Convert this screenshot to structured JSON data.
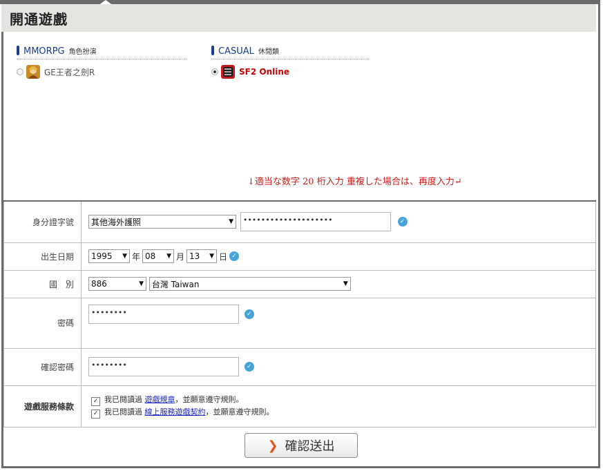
{
  "header": {
    "title": "開通遊戲"
  },
  "categories": [
    {
      "name": "MMORPG",
      "sub": "角色扮演",
      "color": "#1a3d8f"
    },
    {
      "name": "CASUAL",
      "sub": "休閒類",
      "color": "#1a3d8f"
    }
  ],
  "games": [
    {
      "label": "GE王者之劍R",
      "selected": false,
      "icon": "ge-game-icon"
    },
    {
      "label": "SF2 Online",
      "selected": true,
      "icon": "sf2-game-icon"
    }
  ],
  "note": "↓適当な数字 20 桁入力 重複した場合は、再度入力↵",
  "form": {
    "id": {
      "label": "身分證字號",
      "type_value": "其他海外護照",
      "value": "••••••••••••••••••••"
    },
    "birth": {
      "label": "出生日期",
      "year": "1995",
      "year_unit": "年",
      "month": "08",
      "month_unit": "月",
      "day": "13",
      "day_unit": "日"
    },
    "country": {
      "label": "國　別",
      "code": "886",
      "country": "台灣 Taiwan"
    },
    "password": {
      "label": "密碼",
      "value": "••••••••"
    },
    "confirm": {
      "label": "確認密碼",
      "value": "••••••••"
    },
    "terms": {
      "label": "遊戲服務條款",
      "items": [
        {
          "prefix": "我已閱讀過 ",
          "link": "遊戲規章",
          "suffix": "，並願意遵守規則。"
        },
        {
          "prefix": "我已閱讀過 ",
          "link": "線上服務遊戲契約",
          "suffix": "，並願意遵守規則。"
        }
      ]
    }
  },
  "submit": {
    "label": "確認送出"
  }
}
